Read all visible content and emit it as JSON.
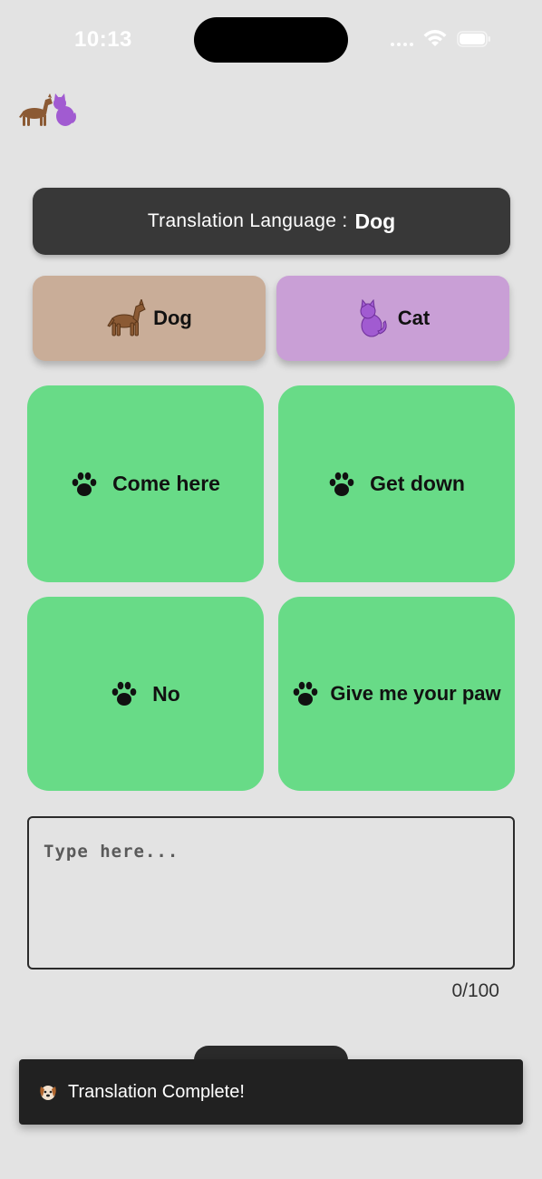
{
  "status_bar": {
    "time": "10:13"
  },
  "banner": {
    "label": "Translation Language :",
    "value": "Dog"
  },
  "animals": [
    {
      "label": "Dog",
      "icon": "dog-icon",
      "color": "#c9ad98"
    },
    {
      "label": "Cat",
      "icon": "cat-icon",
      "color": "#c99fd6"
    }
  ],
  "phrases": [
    {
      "label": "Come here",
      "icon": "paw-icon"
    },
    {
      "label": "Get down",
      "icon": "paw-icon"
    },
    {
      "label": "No",
      "icon": "paw-icon"
    },
    {
      "label": "Give me your paw",
      "icon": "paw-icon"
    }
  ],
  "input": {
    "placeholder": "Type here...",
    "value": "",
    "counter": "0/100"
  },
  "toast": {
    "icon": "dog-face-icon",
    "message": "Translation Complete!"
  },
  "colors": {
    "background": "#e3e3e3",
    "banner": "#383838",
    "phrase_card": "#68db87",
    "toast": "#212121"
  }
}
